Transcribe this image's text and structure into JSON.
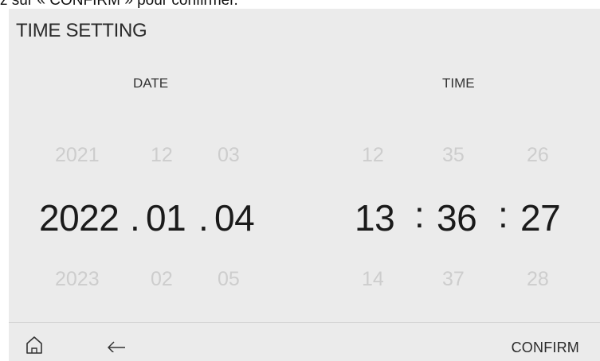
{
  "caption": "z sur « CONFIRM » pour confirmer.",
  "screen": {
    "title": "TIME SETTING",
    "date_label": "DATE",
    "time_label": "TIME"
  },
  "date": {
    "year": {
      "prev": "2021",
      "current": "2022",
      "next": "2023"
    },
    "month": {
      "prev": "12",
      "current": "01",
      "next": "02"
    },
    "day": {
      "prev": "03",
      "current": "04",
      "next": "05"
    },
    "separator": "."
  },
  "time": {
    "hour": {
      "prev": "12",
      "current": "13",
      "next": "14"
    },
    "minute": {
      "prev": "35",
      "current": "36",
      "next": "37"
    },
    "second": {
      "prev": "26",
      "current": "27",
      "next": "28"
    },
    "separator": ":"
  },
  "footer": {
    "confirm_label": "CONFIRM",
    "home_icon": "home-icon",
    "back_icon": "back-arrow-icon"
  }
}
